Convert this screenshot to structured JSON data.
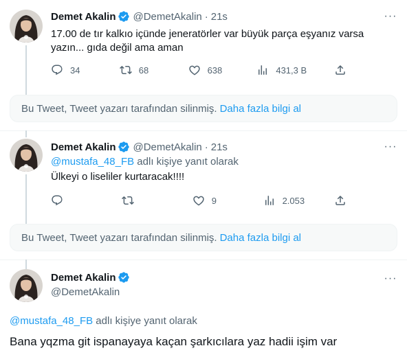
{
  "tweets": [
    {
      "name": "Demet Akalin",
      "handle": "@DemetAkalin",
      "dot": "·",
      "time": "21s",
      "text": "17.00 de tır kalkıo içünde jeneratörler var büyük parça eşyanız varsa yazın... gıda değil ama aman",
      "stats": {
        "replies": "34",
        "retweets": "68",
        "likes": "638",
        "views": "431,3 B"
      }
    },
    {
      "name": "Demet Akalin",
      "handle": "@DemetAkalin",
      "dot": "·",
      "time": "21s",
      "replying_mention": "@mustafa_48_FB",
      "replying_suffix": "adlı kişiye yanıt olarak",
      "text": "Ülkeyi o liseliler kurtaracak!!!!",
      "stats": {
        "replies": "",
        "retweets": "",
        "likes": "9",
        "views": "2.053"
      }
    },
    {
      "name": "Demet Akalin",
      "handle": "@DemetAkalin",
      "replying_mention": "@mustafa_48_FB",
      "replying_suffix": "adlı kişiye yanıt olarak",
      "text": "Bana yqzma git ispanayaya kaçan şarkıcılara yaz hadii işim var"
    }
  ],
  "deleted_notice": {
    "text": "Bu Tweet, Tweet yazarı tarafından silinmiş.",
    "link": "Daha fazla bilgi al"
  },
  "icons": [
    "verified-badge-icon",
    "reply-icon",
    "retweet-icon",
    "like-icon",
    "views-icon",
    "share-icon",
    "more-icon"
  ],
  "colors": {
    "accent": "#1d9bf0",
    "muted": "#536471",
    "text": "#0f1419",
    "line": "#cfd9de",
    "deleted_bg": "#f7f9f9"
  }
}
